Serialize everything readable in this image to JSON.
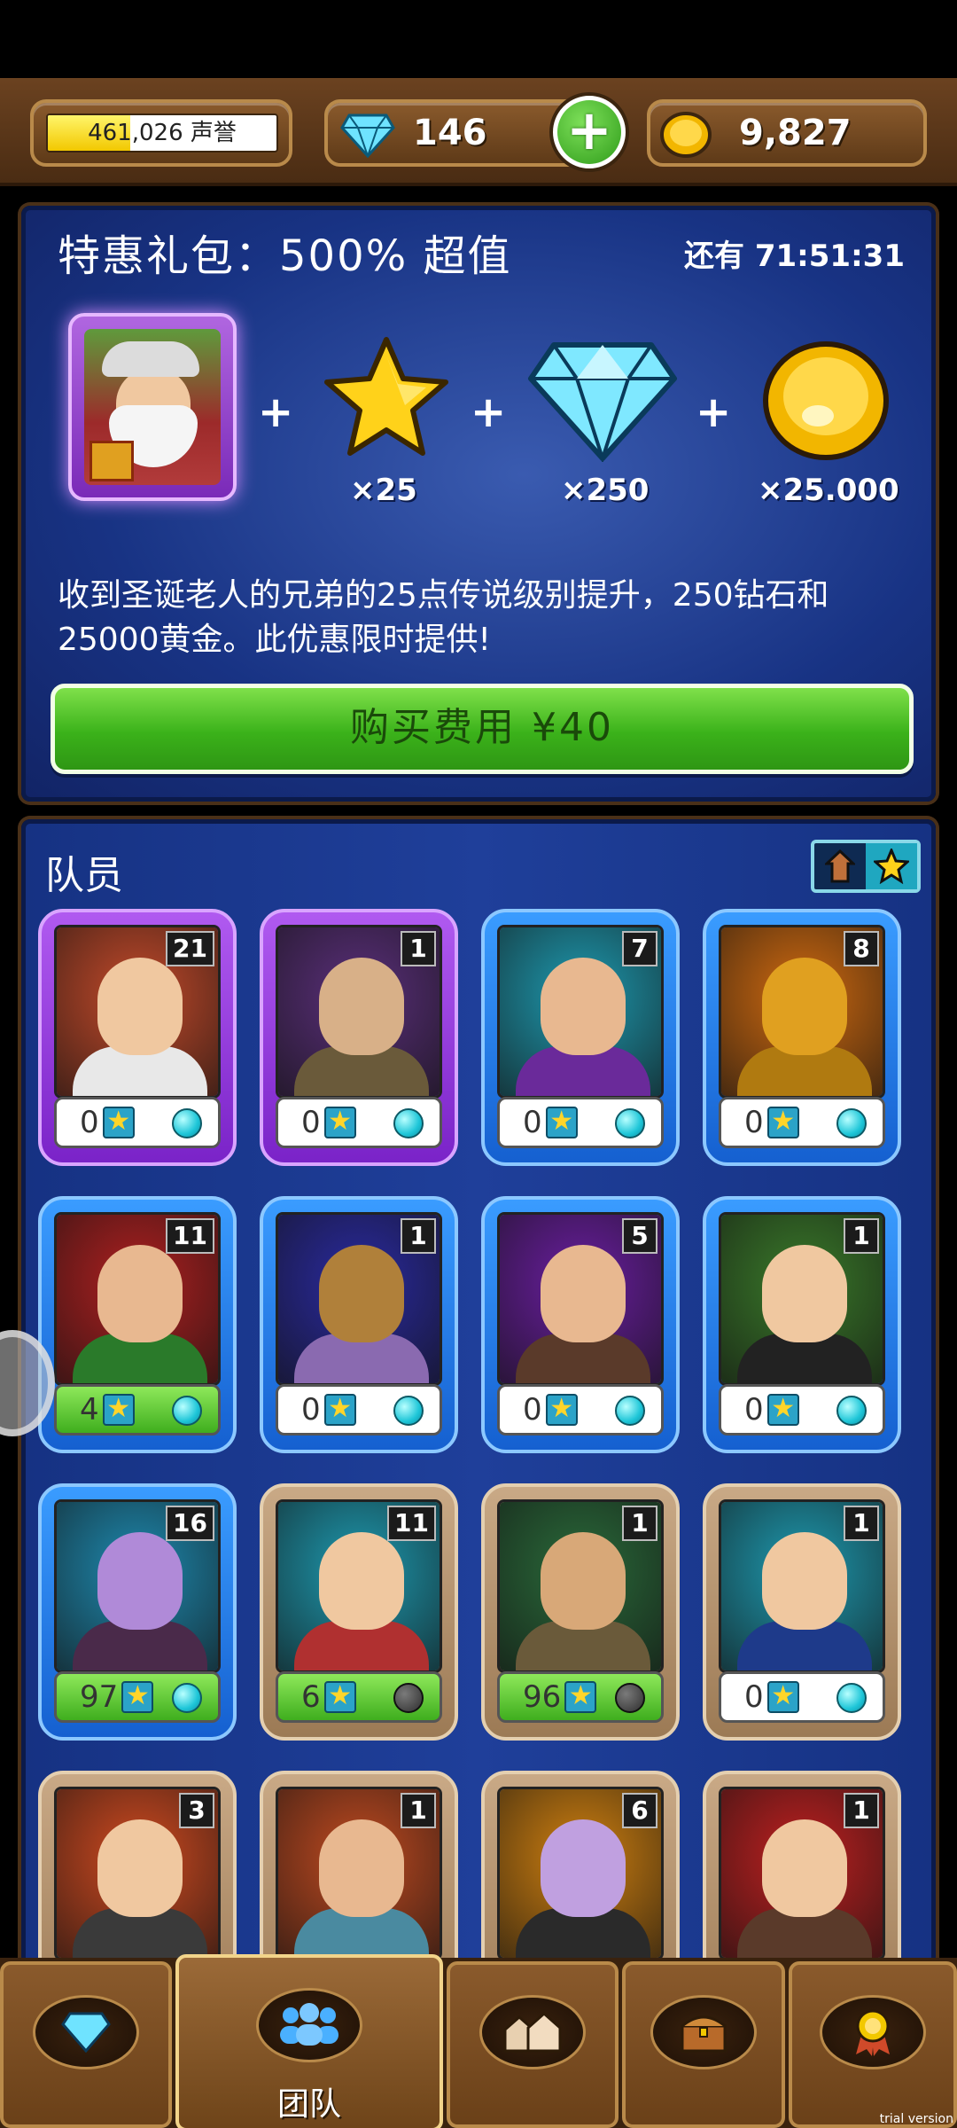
{
  "topbar": {
    "reputation_text": "461,026 声誉",
    "reputation_fill": 0.36,
    "gems": "146",
    "gold": "9,827"
  },
  "offer": {
    "title": "特惠礼包：500% 超值",
    "timer": "还有 71:51:31",
    "rewards": [
      {
        "icon": "star-icon",
        "label": "×25"
      },
      {
        "icon": "diamond-icon",
        "label": "×250"
      },
      {
        "icon": "gold-coin-icon",
        "label": "×25.000"
      }
    ],
    "plus": "+",
    "description": "收到圣诞老人的兄弟的25点传说级别提升，250钻石和25000黄金。此优惠限时提供!",
    "buy_label": "购买费用 ¥40"
  },
  "team": {
    "title": "队员",
    "members": [
      {
        "level": "21",
        "stars": "0",
        "frame": "purple",
        "bar": "white",
        "dot": "on",
        "bg": "#c44a2a",
        "skin": "#f0c8a0",
        "cloth": "#e8e8e8"
      },
      {
        "level": "1",
        "stars": "0",
        "frame": "purple",
        "bar": "white",
        "dot": "on",
        "bg": "#5a2f7a",
        "skin": "#d8b088",
        "cloth": "#6a5a3a"
      },
      {
        "level": "7",
        "stars": "0",
        "frame": "blue",
        "bar": "white",
        "dot": "on",
        "bg": "#1e9ab0",
        "skin": "#e8b890",
        "cloth": "#6a2a9a"
      },
      {
        "level": "8",
        "stars": "0",
        "frame": "blue",
        "bar": "white",
        "dot": "on",
        "bg": "#d06a10",
        "skin": "#e0a020",
        "cloth": "#b07a10"
      },
      {
        "level": "11",
        "stars": "4",
        "frame": "blue",
        "bar": "green",
        "dot": "on",
        "bg": "#b02020",
        "skin": "#e8b890",
        "cloth": "#2a7a2a"
      },
      {
        "level": "1",
        "stars": "0",
        "frame": "blue",
        "bar": "white",
        "dot": "on",
        "bg": "#2a2aa0",
        "skin": "#b0803a",
        "cloth": "#8a6ab0"
      },
      {
        "level": "5",
        "stars": "0",
        "frame": "blue",
        "bar": "white",
        "dot": "on",
        "bg": "#6a1ea0",
        "skin": "#e8b890",
        "cloth": "#5a3a2a"
      },
      {
        "level": "1",
        "stars": "0",
        "frame": "blue",
        "bar": "white",
        "dot": "on",
        "bg": "#3a7a2a",
        "skin": "#f0c8a0",
        "cloth": "#222222"
      },
      {
        "level": "16",
        "stars": "97",
        "frame": "blue",
        "bar": "green",
        "dot": "on",
        "bg": "#1e8ab0",
        "skin": "#b08ad8",
        "cloth": "#4a2a4a"
      },
      {
        "level": "11",
        "stars": "6",
        "frame": "tan",
        "bar": "green",
        "dot": "off",
        "bg": "#1e9ab0",
        "skin": "#f0c8a0",
        "cloth": "#b03030"
      },
      {
        "level": "1",
        "stars": "96",
        "frame": "tan",
        "bar": "green",
        "dot": "off",
        "bg": "#2a6a3a",
        "skin": "#d8a878",
        "cloth": "#6a5a3a"
      },
      {
        "level": "1",
        "stars": "0",
        "frame": "tan",
        "bar": "white",
        "dot": "on",
        "bg": "#1e9ab0",
        "skin": "#f0c8a0",
        "cloth": "#1e3a8a"
      },
      {
        "level": "3",
        "stars": "",
        "frame": "tan",
        "bar": "none",
        "dot": "none",
        "bg": "#d04a20",
        "skin": "#f0c8a0",
        "cloth": "#3a3a3a"
      },
      {
        "level": "1",
        "stars": "",
        "frame": "tan",
        "bar": "none",
        "dot": "none",
        "bg": "#c04a20",
        "skin": "#e8b890",
        "cloth": "#4a8aa0"
      },
      {
        "level": "6",
        "stars": "",
        "frame": "tan",
        "bar": "none",
        "dot": "none",
        "bg": "#d08010",
        "skin": "#c0a0e0",
        "cloth": "#2a2a2a"
      },
      {
        "level": "1",
        "stars": "",
        "frame": "tan",
        "bar": "none",
        "dot": "none",
        "bg": "#c02020",
        "skin": "#f0c8a0",
        "cloth": "#5a3a2a"
      }
    ]
  },
  "nav": {
    "items": [
      {
        "icon": "diamond-icon",
        "label": ""
      },
      {
        "icon": "team-icon",
        "label": "团队"
      },
      {
        "icon": "buildings-icon",
        "label": ""
      },
      {
        "icon": "chest-icon",
        "label": ""
      },
      {
        "icon": "medal-icon",
        "label": ""
      }
    ],
    "watermark": "trial version"
  },
  "colors": {
    "offer_bg": "#183384",
    "buy_green": "#3bb21a",
    "wood": "#6a4018"
  }
}
